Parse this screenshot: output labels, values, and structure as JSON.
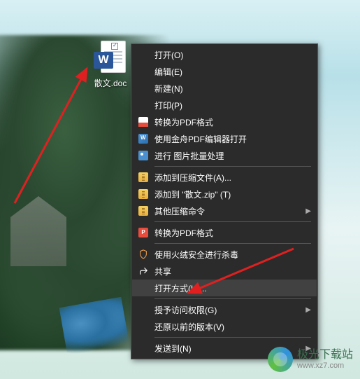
{
  "desktop": {
    "file": {
      "name": "散文.doc",
      "badge_letter": "W"
    }
  },
  "context_menu": {
    "items": [
      {
        "label": "打开(O)",
        "icon": null
      },
      {
        "label": "编辑(E)",
        "icon": null
      },
      {
        "label": "新建(N)",
        "icon": null
      },
      {
        "label": "打印(P)",
        "icon": null
      },
      {
        "label": "转换为PDF格式",
        "icon": "pdf"
      },
      {
        "label": "使用金舟PDF编辑器打开",
        "icon": "jinzhou"
      },
      {
        "label": "进行 图片批量处理",
        "icon": "pic"
      },
      {
        "sep": true
      },
      {
        "label": "添加到压缩文件(A)...",
        "icon": "zip"
      },
      {
        "label": "添加到 \"散文.zip\" (T)",
        "icon": "zip"
      },
      {
        "label": "其他压缩命令",
        "icon": "zip",
        "submenu": true
      },
      {
        "sep": true
      },
      {
        "label": "转换为PDF格式",
        "icon": "wps",
        "icon_text": "P"
      },
      {
        "sep": true
      },
      {
        "label": "使用火绒安全进行杀毒",
        "icon": "shield"
      },
      {
        "label": "共享",
        "icon": "share"
      },
      {
        "label": "打开方式(H)...",
        "icon": null,
        "hover": true
      },
      {
        "sep": true
      },
      {
        "label": "授予访问权限(G)",
        "icon": null,
        "submenu": true
      },
      {
        "label": "还原以前的版本(V)",
        "icon": null
      },
      {
        "sep": true
      },
      {
        "label": "发送到(N)",
        "icon": null,
        "submenu": true
      }
    ]
  },
  "watermark": {
    "name": "极光下载站",
    "url": "www.xz7.com"
  }
}
